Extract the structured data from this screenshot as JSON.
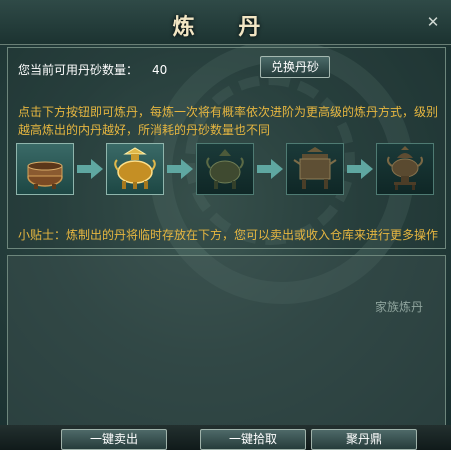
{
  "window": {
    "title": "炼  丹"
  },
  "header": {
    "available_label": "您当前可用丹砂数量：",
    "available_value": "40",
    "exchange_button": "兑换丹砂"
  },
  "description": "点击下方按钮即可炼丹，每炼一次将有概率依次进阶为更高级的炼丹方式，级别越高炼出的内丹越好，所消耗的丹砂数量也不同",
  "furnaces": [
    {
      "icon": "bronze-bowl-furnace-icon"
    },
    {
      "icon": "golden-censer-furnace-icon"
    },
    {
      "icon": "jade-censer-furnace-icon"
    },
    {
      "icon": "tripod-cauldron-furnace-icon"
    },
    {
      "icon": "tall-incense-burner-furnace-icon"
    }
  ],
  "tip": "小贴士：炼制出的丹将临时存放在下方，您可以卖出或收入仓库来进行更多操作",
  "watermark": "家族炼丹",
  "buttons": {
    "sell_all": "一键卖出",
    "pick_all": "一键拾取",
    "gather": "聚丹鼎"
  },
  "colors": {
    "tip_text": "#e6b640",
    "title_text": "#f2e6c4",
    "panel_border": "#6d867c"
  }
}
